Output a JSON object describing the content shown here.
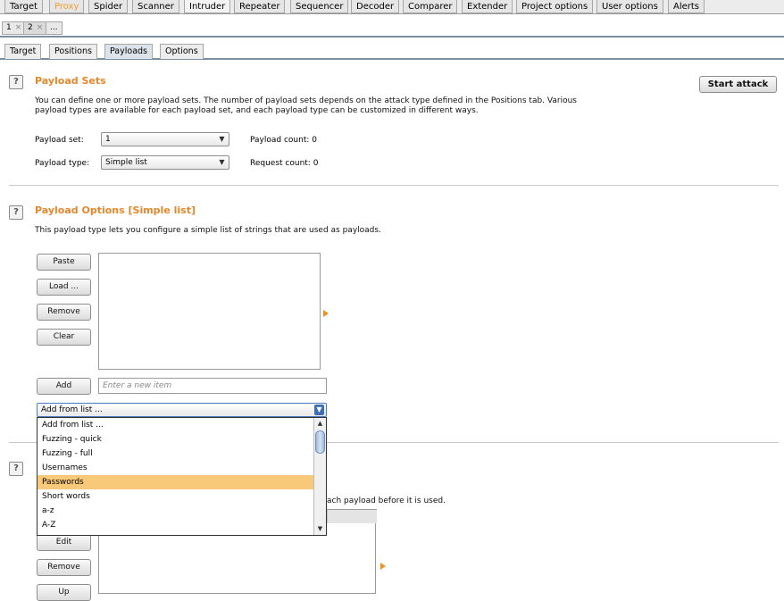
{
  "main_tabs": [
    "Target",
    "Proxy",
    "Spider",
    "Scanner",
    "Intruder",
    "Repeater",
    "Sequencer",
    "Decoder",
    "Comparer",
    "Extender",
    "Project options",
    "User options",
    "Alerts"
  ],
  "intruder_tabs": [
    {
      "label": "1",
      "close": "×"
    },
    {
      "label": "2",
      "close": "×"
    },
    {
      "label": "..."
    }
  ],
  "sub_tabs": [
    "Target",
    "Positions",
    "Payloads",
    "Options"
  ],
  "help_label": "?",
  "payload_sets": {
    "title": "Payload Sets",
    "description_line1": "You can define one or more payload sets. The number of payload sets depends on the attack type defined in the Positions tab. Various",
    "description_line2": "payload types are available for each payload set, and each payload type can be customized in different ways.",
    "start_attack": "Start attack",
    "payload_set_label": "Payload set:",
    "payload_set_value": "1",
    "payload_count": "Payload count:  0",
    "payload_type_label": "Payload type:",
    "payload_type_value": "Simple list",
    "request_count": "Request count:  0"
  },
  "payload_options": {
    "title": "Payload Options [Simple list]",
    "description": "This payload type lets you configure a simple list of strings that are used as payloads.",
    "buttons": [
      "Paste",
      "Load ...",
      "Remove",
      "Clear"
    ],
    "add_button": "Add",
    "new_item_placeholder": "Enter a new item",
    "add_from_list_value": "Add from list ..."
  },
  "dropdown_options": [
    "Add from list ...",
    "Fuzzing - quick",
    "Fuzzing - full",
    "Usernames",
    "Passwords",
    "Short words",
    "a-z",
    "A-Z"
  ],
  "dropdown_highlighted": "Passwords",
  "payload_processing": {
    "description_fragment": "ach payload before it is used.",
    "buttons": [
      "Edit",
      "Remove",
      "Up"
    ]
  },
  "colors": {
    "section_title": "#e5872a",
    "highlight": "#f9c97a",
    "proxy_tab": "#f0a030",
    "tab_underline": "#7a8fa0"
  },
  "icons": {
    "dropdown_arrow": "▼",
    "scroll_up": "▲",
    "scroll_down": "▼"
  }
}
